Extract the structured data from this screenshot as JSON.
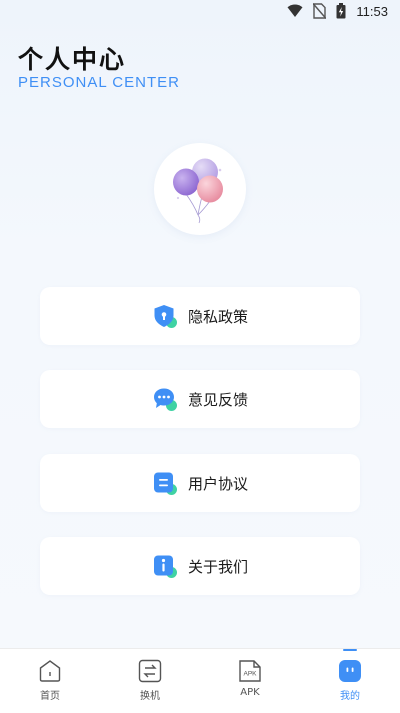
{
  "status_bar": {
    "time": "11:53",
    "icons": [
      "wifi-icon",
      "no-sim-icon",
      "battery-charging-icon"
    ]
  },
  "header": {
    "title": "个人中心",
    "subtitle": "PERSONAL CENTER"
  },
  "avatar": {
    "icon": "balloons-icon"
  },
  "menu": [
    {
      "label": "隐私政策",
      "icon": "privacy-shield-icon"
    },
    {
      "label": "意见反馈",
      "icon": "feedback-chat-icon"
    },
    {
      "label": "用户协议",
      "icon": "user-agreement-icon"
    },
    {
      "label": "关于我们",
      "icon": "info-icon"
    }
  ],
  "nav": {
    "active_index": 3,
    "items": [
      {
        "label": "首页",
        "icon": "home-icon"
      },
      {
        "label": "换机",
        "icon": "transfer-icon"
      },
      {
        "label": "APK",
        "icon": "apk-file-icon",
        "icon_text": "APK"
      },
      {
        "label": "我的",
        "icon": "profile-icon"
      }
    ]
  },
  "colors": {
    "accent": "#3f8ff5",
    "icon_badge": "#3fd2a3",
    "background": "#eef4fb"
  }
}
